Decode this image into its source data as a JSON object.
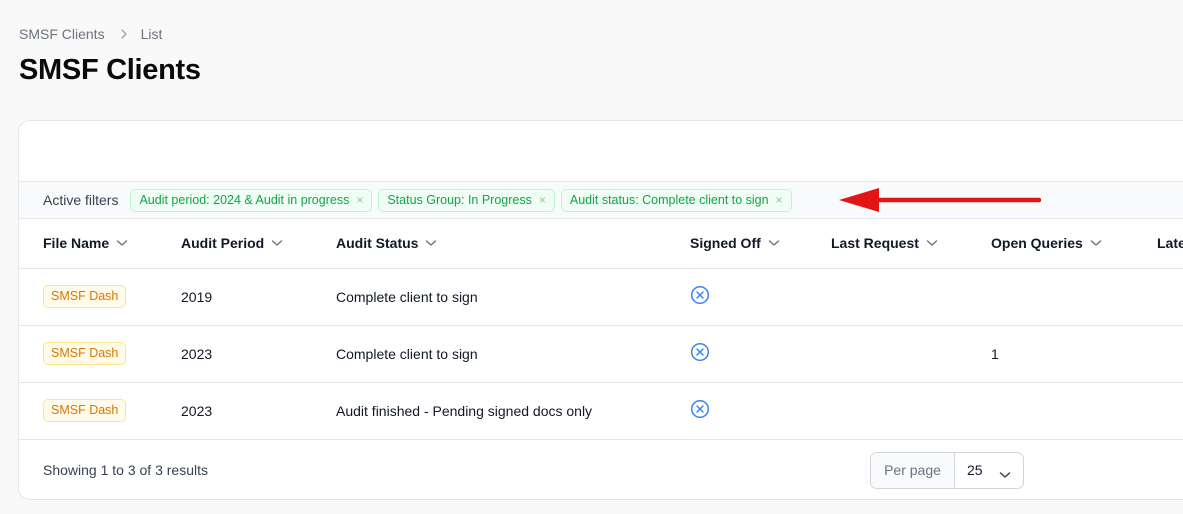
{
  "breadcrumb": {
    "root": "SMSF Clients",
    "current": "List"
  },
  "page": {
    "title": "SMSF Clients"
  },
  "filters": {
    "label": "Active filters",
    "chips": [
      "Audit period: 2024 & Audit in progress",
      "Status Group: In Progress",
      "Audit status: Complete client to sign"
    ],
    "remove_glyph": "×"
  },
  "table": {
    "columns": [
      "File Name",
      "Audit Period",
      "Audit Status",
      "Signed Off",
      "Last Request",
      "Open Queries",
      "Late"
    ],
    "rows": [
      {
        "file_name": "SMSF Dash",
        "audit_period": "2019",
        "audit_status": "Complete client to sign",
        "signed_off": "x-circle-icon",
        "last_request": "",
        "open_queries": ""
      },
      {
        "file_name": "SMSF Dash",
        "audit_period": "2023",
        "audit_status": "Complete client to sign",
        "signed_off": "x-circle-icon",
        "last_request": "",
        "open_queries": "1"
      },
      {
        "file_name": "SMSF Dash",
        "audit_period": "2023",
        "audit_status": "Audit finished - Pending signed docs only",
        "signed_off": "x-circle-icon",
        "last_request": "",
        "open_queries": ""
      }
    ]
  },
  "footer": {
    "results": "Showing 1 to 3 of 3 results",
    "per_page_label": "Per page",
    "per_page_value": "25"
  },
  "colors": {
    "accent_green": "#16a34a",
    "badge_amber": "#d97706",
    "signoff_blue": "#3b82f6",
    "annotation_arrow": "#e31414"
  }
}
